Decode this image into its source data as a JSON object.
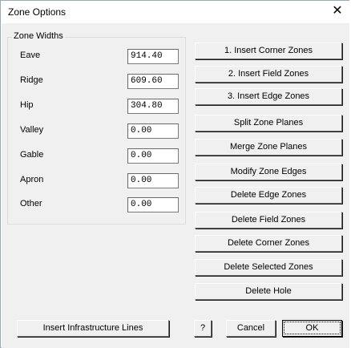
{
  "window": {
    "title": "Zone Options",
    "close_glyph": "✕"
  },
  "zone_widths": {
    "group_label": "Zone Widths",
    "fields": [
      {
        "label": "Eave",
        "value": "914.40"
      },
      {
        "label": "Ridge",
        "value": "609.60"
      },
      {
        "label": "Hip",
        "value": "304.80"
      },
      {
        "label": "Valley",
        "value": "0.00"
      },
      {
        "label": "Gable",
        "value": "0.00"
      },
      {
        "label": "Apron",
        "value": "0.00"
      },
      {
        "label": "Other",
        "value": "0.00"
      }
    ]
  },
  "actions": [
    "1. Insert Corner Zones",
    "2. Insert Field Zones",
    "3. Insert Edge Zones",
    "Split Zone Planes",
    "Merge Zone Planes",
    "Modify Zone Edges",
    "Delete Edge Zones",
    "Delete Field Zones",
    "Delete Corner Zones",
    "Delete Selected Zones",
    "Delete Hole"
  ],
  "footer": {
    "infrastructure_label": "Insert Infrastructure Lines",
    "help_label": "?",
    "cancel_label": "Cancel",
    "ok_label": "OK"
  }
}
